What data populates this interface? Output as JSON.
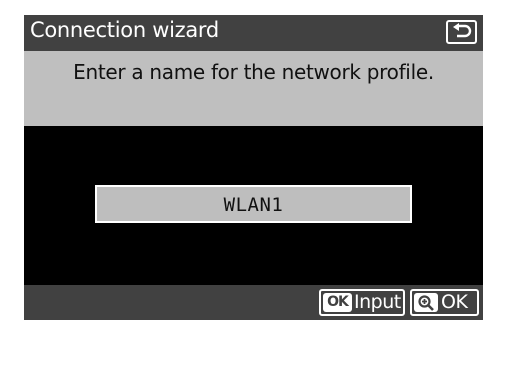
{
  "header": {
    "title": "Connection wizard",
    "back_icon": "return-arrow-icon"
  },
  "prompt": {
    "text": "Enter a name for the network profile."
  },
  "name_field": {
    "value": "WLAN1"
  },
  "footer": {
    "input_key": "OK",
    "input_label": "Input",
    "confirm_key_icon": "zoom-in-icon",
    "confirm_label": "OK"
  },
  "colors": {
    "bar": "#414141",
    "prompt_band": "#bfbfbf",
    "field": "#bebebe",
    "background": "#000000"
  }
}
